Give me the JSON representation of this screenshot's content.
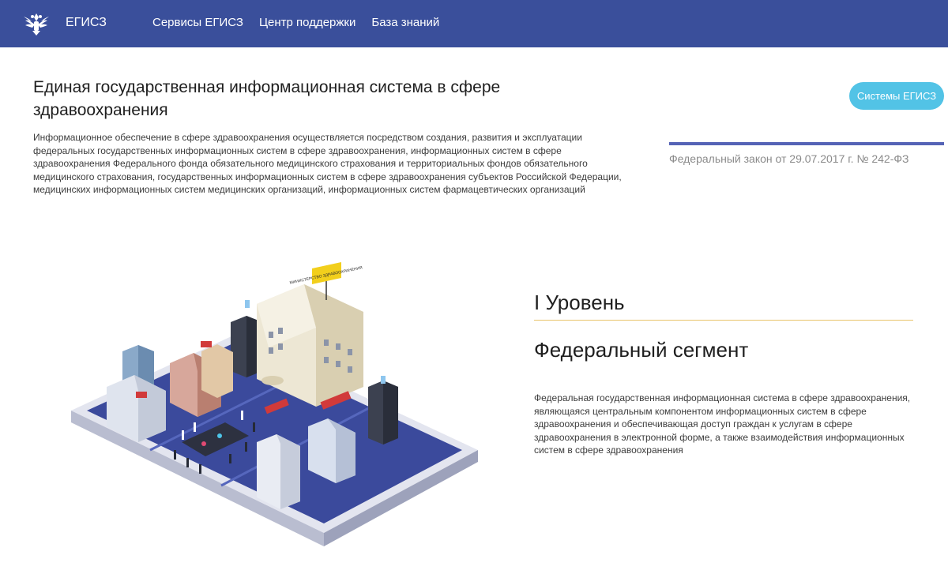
{
  "header": {
    "brand": "ЕГИСЗ",
    "nav": [
      "Сервисы ЕГИСЗ",
      "Центр поддержки",
      "База знаний"
    ]
  },
  "hero": {
    "title": "Единая государственная информационная система в сфере здравоохранения",
    "description": "Информационное обеспечение в сфере здравоохранения осуществляется посредством создания, развития и эксплуатации федеральных государственных информационных систем в сфере здравоохранения, информационных систем в сфере здравоохранения Федерального фонда обязательного медицинского страхования и территориальных фондов обязательного медицинского страхования, государственных информационных систем в сфере здравоохранения субъектов Российской Федерации, медицинских информационных систем медицинских организаций, информационных систем фармацевтических организаций",
    "button": "Системы ЕГИСЗ",
    "law": "Федеральный закон от 29.07.2017 г. № 242-ФЗ"
  },
  "level_section": {
    "level": "I Уровень",
    "segment": "Федеральный сегмент",
    "description": "Федеральная государственная информационная система в сфере здравоохранения, являющаяся центральным компонентом информационных систем в сфере здравоохранения и обеспечивающая доступ граждан к услугам в сфере здравоохранения в электронной форме, а также взаимодействия информационных систем в сфере здравоохранения"
  },
  "illustration": {
    "flag_main": "МИНИСТЕРСТВО ЗДРАВООХРАНЕНИЯ"
  },
  "colors": {
    "header_bg": "#3a4f9b",
    "button_bg": "#52c3e6",
    "law_line": "#5563b6",
    "level_line": "#e8c36a"
  }
}
